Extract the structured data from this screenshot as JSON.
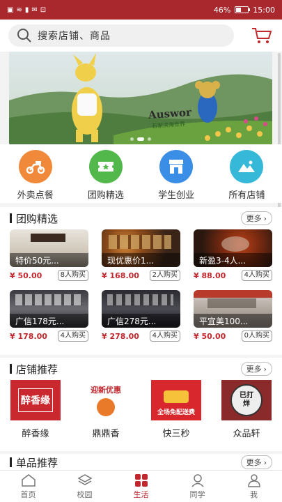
{
  "status_bar": {
    "left_icons": [
      "sim-icon",
      "wifi-icon",
      "signal-icon",
      "message-icon",
      "vpn-icon"
    ],
    "battery": "46%",
    "battery_level": 0.46,
    "time": "15:00"
  },
  "header": {
    "search_placeholder": "搜索店铺、商品",
    "cart_icon": "cart-icon"
  },
  "banner": {
    "title": "Auswor",
    "subtitle": "石家滨海世界",
    "slide_count": 3,
    "active_slide": 1
  },
  "quick_nav": [
    {
      "label": "外卖点餐",
      "icon": "scooter-icon",
      "color": "#f08a3a"
    },
    {
      "label": "团购精选",
      "icon": "ticket-icon",
      "color": "#52b84c"
    },
    {
      "label": "学生创业",
      "icon": "storefront-icon",
      "color": "#3a8ee6"
    },
    {
      "label": "所有店铺",
      "icon": "mountain-icon",
      "color": "#36b8d8"
    }
  ],
  "group_buy": {
    "title": "团购精选",
    "more_label": "更多",
    "items": [
      {
        "caption": "特价50元...",
        "price": "¥ 50.00",
        "sold": "8人购买"
      },
      {
        "caption": "现优惠价1...",
        "price": "¥ 168.00",
        "sold": "2人购买"
      },
      {
        "caption": "新盈3-4人...",
        "price": "¥ 88.00",
        "sold": "4人购买"
      },
      {
        "caption": "广信178元...",
        "price": "¥ 178.00",
        "sold": "4人购买"
      },
      {
        "caption": "广信278元...",
        "price": "¥ 278.00",
        "sold": "4人购买"
      },
      {
        "caption": "平宜美100...",
        "price": "¥ 50.00",
        "sold": "0人购买"
      }
    ]
  },
  "shop_recommend": {
    "title": "店铺推荐",
    "more_label": "更多",
    "shops": [
      {
        "name": "醉香缘",
        "logo_text": "醉香缘"
      },
      {
        "name": "鼎鼎香",
        "logo_text": "迎新优惠"
      },
      {
        "name": "快三秒",
        "logo_text": "全场免配送费"
      },
      {
        "name": "众品轩",
        "logo_text": "已打烊"
      }
    ]
  },
  "item_recommend": {
    "title": "单品推荐",
    "more_label": "更多"
  },
  "tabbar": [
    {
      "label": "首页",
      "icon": "home-icon",
      "active": false
    },
    {
      "label": "校园",
      "icon": "layers-icon",
      "active": false
    },
    {
      "label": "生活",
      "icon": "grid-icon",
      "active": true
    },
    {
      "label": "同学",
      "icon": "people-icon",
      "active": false
    },
    {
      "label": "我",
      "icon": "person-icon",
      "active": false
    }
  ],
  "colors": {
    "brand": "#a8282e",
    "price": "#c0282e"
  }
}
